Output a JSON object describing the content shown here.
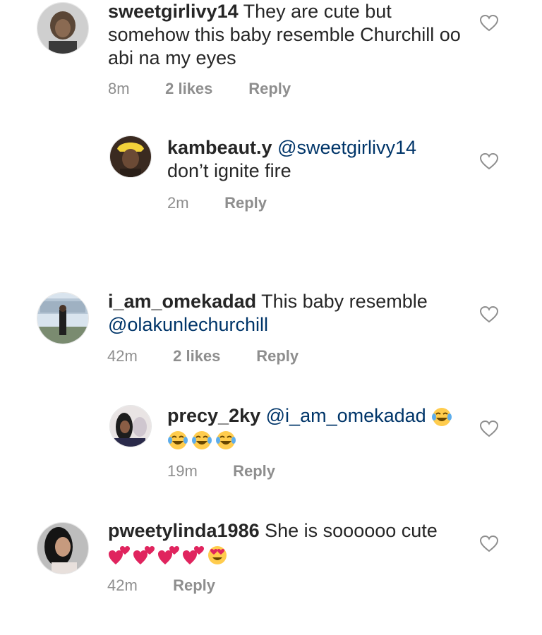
{
  "comments": [
    {
      "username": "sweetgirlivy14",
      "text": "They are cute but somehow this baby resemble Churchill oo abi na my eyes",
      "time": "8m",
      "likes": "2 likes",
      "reply": "Reply"
    },
    {
      "username": "kambeaut.y",
      "mention": "@sweetgirlivy14",
      "text": "don’t ignite fire",
      "time": "2m",
      "reply": "Reply"
    },
    {
      "username": "i_am_omekadad",
      "text": "This baby resemble",
      "mention": "@olakunlechurchill",
      "time": "42m",
      "likes": "2 likes",
      "reply": "Reply"
    },
    {
      "username": "precy_2ky",
      "mention": "@i_am_omekadad",
      "emoji": "face-with-tears-of-joy x4",
      "time": "19m",
      "reply": "Reply"
    },
    {
      "username": "pweetylinda1986",
      "text": "She is soooooo cute",
      "emoji": "two-hearts x4, heart-eyes x1",
      "time": "42m",
      "reply": "Reply"
    }
  ],
  "icons": {
    "like": "heart-outline-icon",
    "laugh": "face-with-tears-of-joy-emoji",
    "hearts": "two-hearts-emoji",
    "heart_eyes": "smiling-face-with-heart-eyes-emoji"
  },
  "colors": {
    "text": "#262626",
    "meta": "#8e8e8e",
    "mention": "#003569",
    "heart_emoji": "#e0245e",
    "emoji_face": "#ffcc4d"
  }
}
